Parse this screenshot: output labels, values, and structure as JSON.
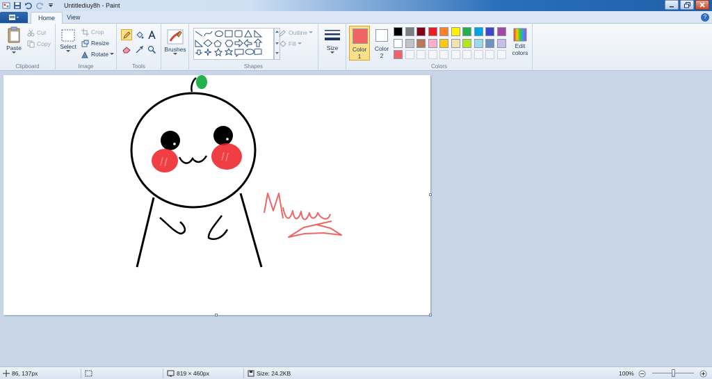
{
  "window": {
    "title": "Untitlediuy8h - Paint"
  },
  "tabs": [
    {
      "label": "Home"
    },
    {
      "label": "View"
    }
  ],
  "ribbon": {
    "clipboard": {
      "label": "Clipboard",
      "paste": "Paste",
      "cut": "Cut",
      "copy": "Copy"
    },
    "image": {
      "label": "Image",
      "select": "Select",
      "crop": "Crop",
      "resize": "Resize",
      "rotate": "Rotate"
    },
    "tools": {
      "label": "Tools"
    },
    "brushes": {
      "label": "Brushes"
    },
    "shapes": {
      "label": "Shapes",
      "outline": "Outline",
      "fill": "Fill"
    },
    "size": {
      "label": "Size"
    },
    "colors": {
      "label": "Colors",
      "color1_line1": "Color",
      "color1_line2": "1",
      "color2_line1": "Color",
      "color2_line2": "2",
      "edit_line1": "Edit",
      "edit_line2": "colors",
      "color1_value": "#ef6565",
      "color2_value": "#ffffff",
      "palette_row1": [
        "#000000",
        "#7f7f7f",
        "#880015",
        "#ed1c24",
        "#ff7f27",
        "#fff200",
        "#22b14c",
        "#00a2e8",
        "#3f48cc",
        "#a349a4"
      ],
      "palette_row2": [
        "#ffffff",
        "#c3c3c3",
        "#b97a57",
        "#ffaec9",
        "#ffc90e",
        "#efe4b0",
        "#b5e61d",
        "#99d9ea",
        "#7092be",
        "#c8bfe7"
      ],
      "palette_row3": [
        "#ef6565",
        "",
        "",
        "",
        "",
        "",
        "",
        "",
        "",
        ""
      ]
    }
  },
  "drawing": {
    "colors": {
      "outline": "#000000",
      "leaf": "#22b14c",
      "cheeks": "#ed1c24",
      "signature": "#ef6565"
    }
  },
  "status": {
    "cursor_pos": "86, 137px",
    "image_dims": "819 × 460px",
    "file_size": "Size: 24.2KB",
    "zoom": "100%"
  }
}
